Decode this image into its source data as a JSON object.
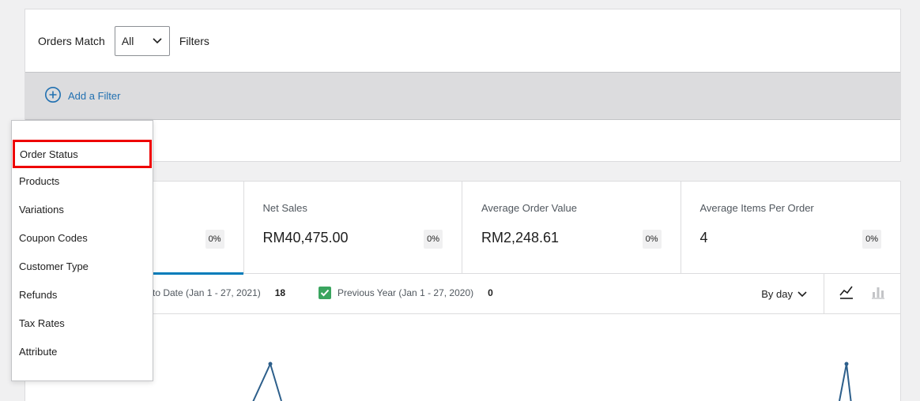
{
  "filters": {
    "match_label": "Orders Match",
    "match_value": "All",
    "filters_label": "Filters",
    "add_filter": "Add a Filter"
  },
  "stats": [
    {
      "label": "",
      "value": "",
      "delta": "0%"
    },
    {
      "label": "Net Sales",
      "value": "RM40,475.00",
      "delta": "0%"
    },
    {
      "label": "Average Order Value",
      "value": "RM2,248.61",
      "delta": "0%"
    },
    {
      "label": "Average Items Per Order",
      "value": "4",
      "delta": "0%"
    }
  ],
  "legend": {
    "current_label": "to Date (Jan 1 - 27, 2021)",
    "current_count": "18",
    "previous_label": "Previous Year (Jan 1 - 27, 2020)",
    "previous_count": "0",
    "interval": "By day"
  },
  "dropdown": {
    "items": [
      "Order Status",
      "Products",
      "Variations",
      "Coupon Codes",
      "Customer Type",
      "Refunds",
      "Tax Rates",
      "Attribute"
    ]
  },
  "colors": {
    "accent": "#007cba",
    "link": "#2271b1",
    "highlight": "#ee0000",
    "checkbox": "#3aa55f",
    "chart_line": "#2d5f8b"
  }
}
